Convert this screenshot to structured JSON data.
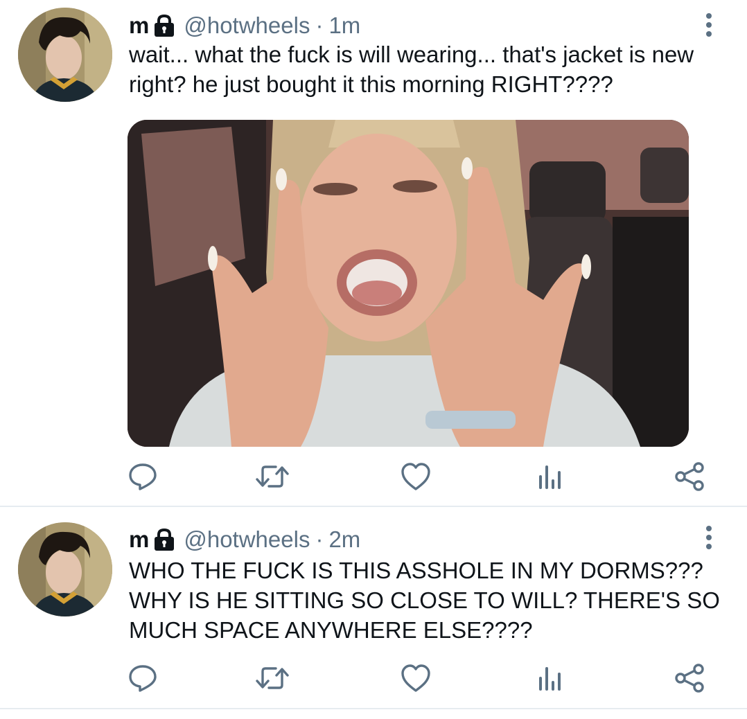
{
  "tweets": [
    {
      "display_name": "m",
      "handle": "@hotwheels",
      "separator": "·",
      "time": "1m",
      "text": "wait... what the fuck is will wearing... that's jacket is new right? he just bought it this morning RIGHT????",
      "has_media": true
    },
    {
      "display_name": "m",
      "handle": "@hotwheels",
      "separator": "·",
      "time": "2m",
      "text": "WHO THE FUCK IS THIS ASSHOLE IN MY DORMS??? WHY IS HE SITTING SO CLOSE TO WILL? THERE'S SO MUCH SPACE ANYWHERE ELSE????",
      "has_media": false
    }
  ],
  "icons": {
    "protected": "lock-icon",
    "more": "more-vertical-icon",
    "reply": "reply-icon",
    "retweet": "retweet-icon",
    "like": "heart-icon",
    "analytics": "analytics-icon",
    "share": "share-icon"
  },
  "colors": {
    "text": "#0f1419",
    "secondary": "#5b7083",
    "divider": "#e6ecf0",
    "background": "#ffffff"
  }
}
